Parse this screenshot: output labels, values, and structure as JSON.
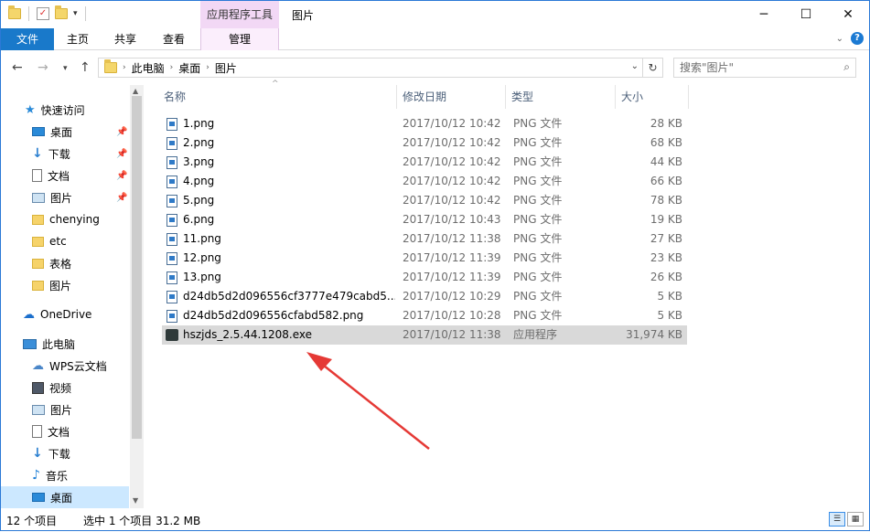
{
  "titlebar": {
    "context_tab": "应用程序工具",
    "title": "图片",
    "minimize": "─",
    "maximize": "☐",
    "close": "✕"
  },
  "ribbon": {
    "tabs": [
      "文件",
      "主页",
      "共享",
      "查看",
      "管理"
    ]
  },
  "address": {
    "back": "←",
    "forward": "→",
    "up": "↑",
    "crumbs": [
      "此电脑",
      "桌面",
      "图片"
    ],
    "refresh": "↻"
  },
  "search": {
    "placeholder": "搜索\"图片\""
  },
  "sidebar": {
    "items": [
      {
        "label": "快速访问",
        "icon": "star-icon"
      },
      {
        "label": "桌面",
        "icon": "desktop-icon",
        "pinned": true
      },
      {
        "label": "下载",
        "icon": "download-icon",
        "pinned": true
      },
      {
        "label": "文档",
        "icon": "document-icon",
        "pinned": true
      },
      {
        "label": "图片",
        "icon": "pictures-icon",
        "pinned": true
      },
      {
        "label": "chenying",
        "icon": "folder-icon"
      },
      {
        "label": "etc",
        "icon": "folder-icon"
      },
      {
        "label": "表格",
        "icon": "folder-icon"
      },
      {
        "label": "图片",
        "icon": "folder-icon"
      },
      {
        "label": "OneDrive",
        "icon": "cloud-icon"
      },
      {
        "label": "此电脑",
        "icon": "computer-icon"
      },
      {
        "label": "WPS云文档",
        "icon": "wps-cloud-icon"
      },
      {
        "label": "视频",
        "icon": "video-icon"
      },
      {
        "label": "图片",
        "icon": "pictures-icon"
      },
      {
        "label": "文档",
        "icon": "document-icon"
      },
      {
        "label": "下载",
        "icon": "download-icon"
      },
      {
        "label": "音乐",
        "icon": "music-icon"
      },
      {
        "label": "桌面",
        "icon": "desktop-icon",
        "selected": true
      }
    ]
  },
  "columns": [
    "名称",
    "修改日期",
    "类型",
    "大小"
  ],
  "files": [
    {
      "name": "1.png",
      "date": "2017/10/12 10:42",
      "type": "PNG 文件",
      "size": "28 KB"
    },
    {
      "name": "2.png",
      "date": "2017/10/12 10:42",
      "type": "PNG 文件",
      "size": "68 KB"
    },
    {
      "name": "3.png",
      "date": "2017/10/12 10:42",
      "type": "PNG 文件",
      "size": "44 KB"
    },
    {
      "name": "4.png",
      "date": "2017/10/12 10:42",
      "type": "PNG 文件",
      "size": "66 KB"
    },
    {
      "name": "5.png",
      "date": "2017/10/12 10:42",
      "type": "PNG 文件",
      "size": "78 KB"
    },
    {
      "name": "6.png",
      "date": "2017/10/12 10:43",
      "type": "PNG 文件",
      "size": "19 KB"
    },
    {
      "name": "11.png",
      "date": "2017/10/12 11:38",
      "type": "PNG 文件",
      "size": "27 KB"
    },
    {
      "name": "12.png",
      "date": "2017/10/12 11:39",
      "type": "PNG 文件",
      "size": "23 KB"
    },
    {
      "name": "13.png",
      "date": "2017/10/12 11:39",
      "type": "PNG 文件",
      "size": "26 KB"
    },
    {
      "name": "d24db5d2d096556cf3777e479cabd5...",
      "date": "2017/10/12 10:29",
      "type": "PNG 文件",
      "size": "5 KB"
    },
    {
      "name": "d24db5d2d096556cfabd582.png",
      "date": "2017/10/12 10:28",
      "type": "PNG 文件",
      "size": "5 KB"
    },
    {
      "name": "hszjds_2.5.44.1208.exe",
      "date": "2017/10/12 11:38",
      "type": "应用程序",
      "size": "31,974 KB",
      "selected": true
    }
  ],
  "status": {
    "count": "12 个项目",
    "selection": "选中 1 个项目  31.2 MB"
  },
  "colors": {
    "file_tab": "#1979ca",
    "context_tab": "#f2d8f5",
    "selection": "#d9d9d9",
    "nav_selection": "#cce8ff",
    "annotation_arrow": "#e53935"
  }
}
